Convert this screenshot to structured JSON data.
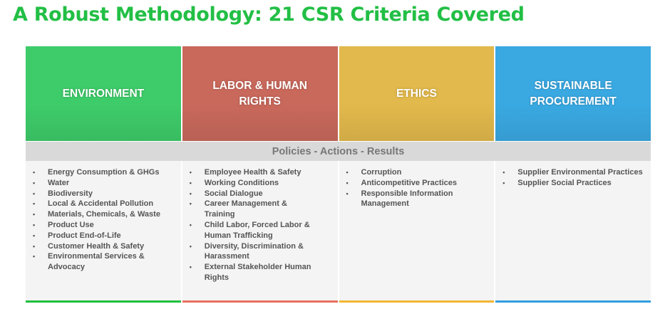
{
  "title": "A Robust Methodology: 21 CSR Criteria Covered",
  "band": "Policies - Actions - Results",
  "columns": [
    {
      "heading": "ENVIRONMENT",
      "color": "#3ecc6a",
      "items": [
        "Energy Consumption & GHGs",
        "Water",
        "Biodiversity",
        "Local & Accidental Pollution",
        "Materials, Chemicals, & Waste",
        "Product Use",
        "Product End-of-Life",
        "Customer Health & Safety",
        "Environmental Services & Advocacy"
      ]
    },
    {
      "heading": "LABOR & HUMAN RIGHTS",
      "color": "#c9695c",
      "items": [
        "Employee Health & Safety",
        "Working Conditions",
        "Social Dialogue",
        "Career Management & Training",
        "Child Labor, Forced Labor & Human Trafficking",
        "Diversity, Discrimination & Harassment",
        "External Stakeholder Human Rights"
      ]
    },
    {
      "heading": "ETHICS",
      "color": "#e2b94c",
      "items": [
        "Corruption",
        "Anticompetitive Practices",
        "Responsible Information Management"
      ]
    },
    {
      "heading": "SUSTAINABLE PROCUREMENT",
      "color": "#3aa9e2",
      "items": [
        "Supplier Environmental Practices",
        "Supplier Social Practices"
      ]
    }
  ],
  "bar_colors": [
    "#1fbf3f",
    "#e9705f",
    "#f2b634",
    "#2f9fe0"
  ]
}
